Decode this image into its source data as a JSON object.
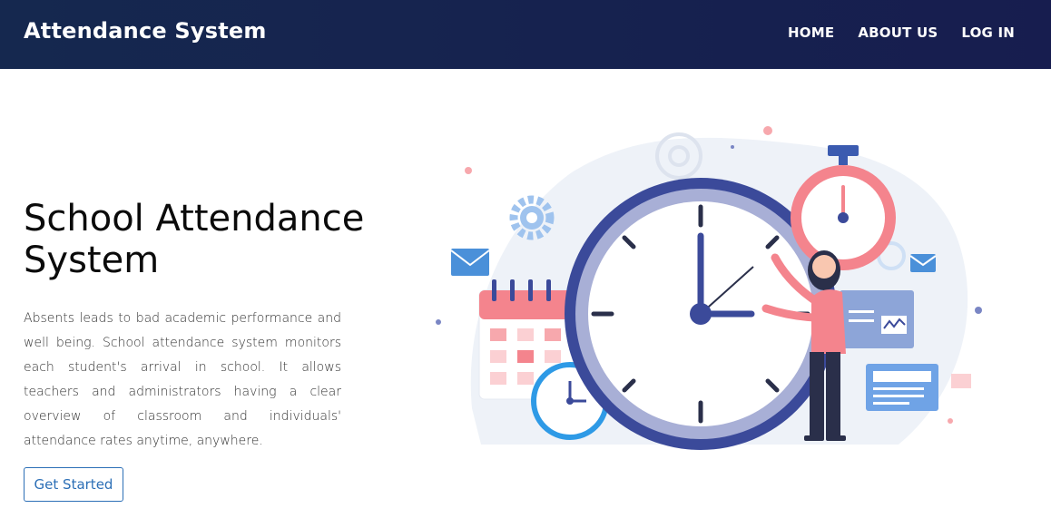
{
  "navbar": {
    "brand": "Attendance System",
    "links": [
      "HOME",
      "ABOUT US",
      "LOG IN"
    ]
  },
  "hero": {
    "title": "School Attendance System",
    "description": "Absents leads to bad academic performance and well being. School attendance system monitors each student's arrival in school. It allows teachers and administrators having a clear overview of classroom and individuals' attendance rates anytime, anywhere.",
    "cta_label": "Get Started"
  },
  "colors": {
    "navbar_bg": "#15284f",
    "accent": "#2c6fb6",
    "clock_ring": "#3b4a9a",
    "stopwatch": "#f4848d",
    "illustration_light_blue": "#5b9be0"
  },
  "illustration": {
    "icons": [
      "clock-icon",
      "stopwatch-icon",
      "calendar-icon",
      "envelope-icon",
      "gear-icon",
      "chart-card-icon",
      "document-card-icon",
      "woman-figure"
    ]
  }
}
